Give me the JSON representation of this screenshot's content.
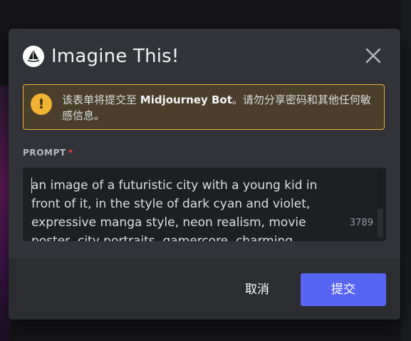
{
  "modal": {
    "title": "Imagine This!",
    "warning": {
      "text_before": "该表单将提交至 ",
      "bot_name": "Midjourney Bot",
      "text_after": "。请勿分享密码和其他任何敏感信息。"
    },
    "field": {
      "label": "PROMPT",
      "required_mark": "*",
      "value": "an image of a futuristic city with a young kid in front of it, in the style of dark cyan and violet, expressive manga style, neon realism, movie poster, city portraits, gamercore, charming",
      "char_count": "3789"
    },
    "footer": {
      "cancel_label": "取消",
      "submit_label": "提交"
    }
  },
  "colors": {
    "modal_bg": "#313338",
    "footer_bg": "#2b2d31",
    "warning_border": "#f0b232",
    "warning_bg": "#4a3f2a",
    "primary": "#5865f2",
    "required": "#f23f42"
  },
  "icons": {
    "app": "midjourney-sailboat-icon",
    "close": "close-icon",
    "warning": "exclamation-icon"
  }
}
